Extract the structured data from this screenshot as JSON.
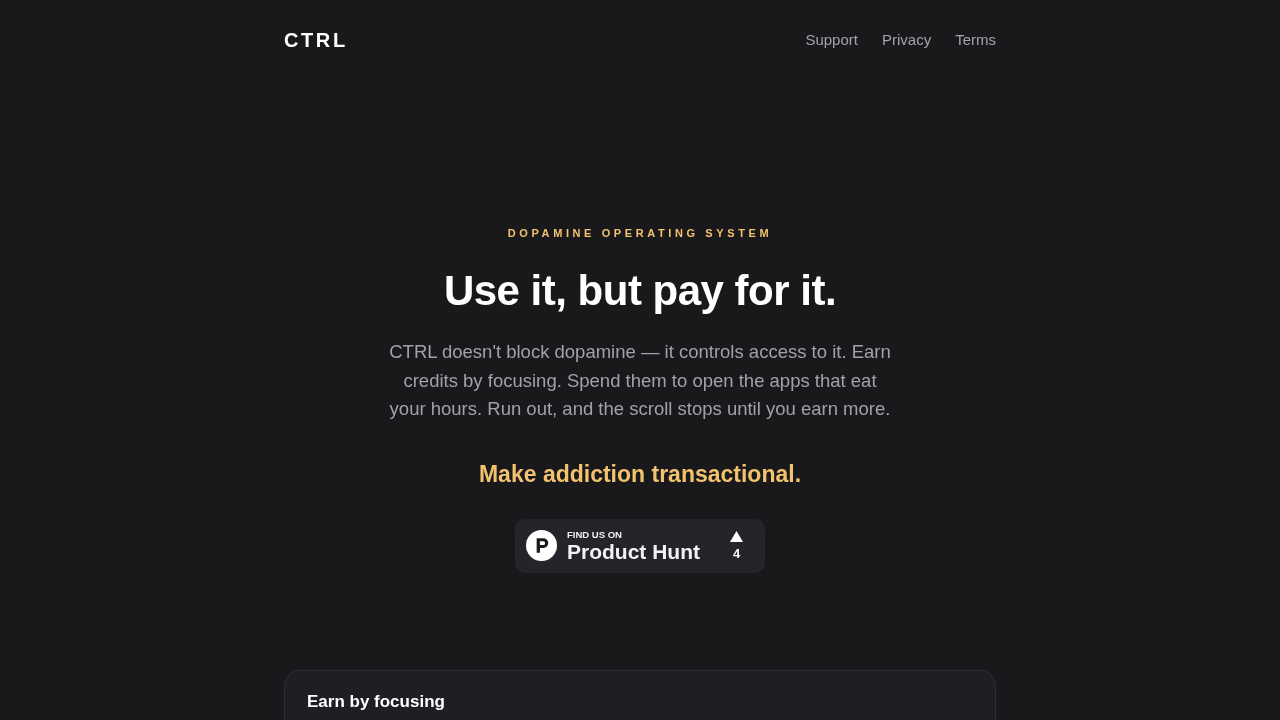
{
  "header": {
    "logo": "CTRL",
    "nav": [
      "Support",
      "Privacy",
      "Terms"
    ]
  },
  "hero": {
    "eyebrow": "DOPAMINE OPERATING SYSTEM",
    "headline": "Use it, but pay for it.",
    "description": "CTRL doesn't block dopamine — it controls access to it. Earn credits by focusing. Spend them to open the apps that eat your hours. Run out, and the scroll stops until you earn more.",
    "tagline": "Make addiction transactional.",
    "badge": {
      "caption": "FIND US ON",
      "title": "Product Hunt",
      "upvotes": "4"
    }
  },
  "feature_card": {
    "title": "Earn by focusing"
  }
}
